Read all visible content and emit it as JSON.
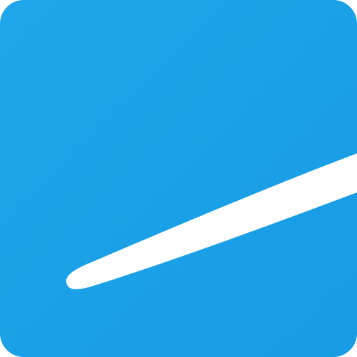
{
  "icon": {
    "name": "app-icon",
    "background_color": "#1aa0e6",
    "stroke_color": "#ffffff",
    "glyph": "white-swoosh-line"
  }
}
